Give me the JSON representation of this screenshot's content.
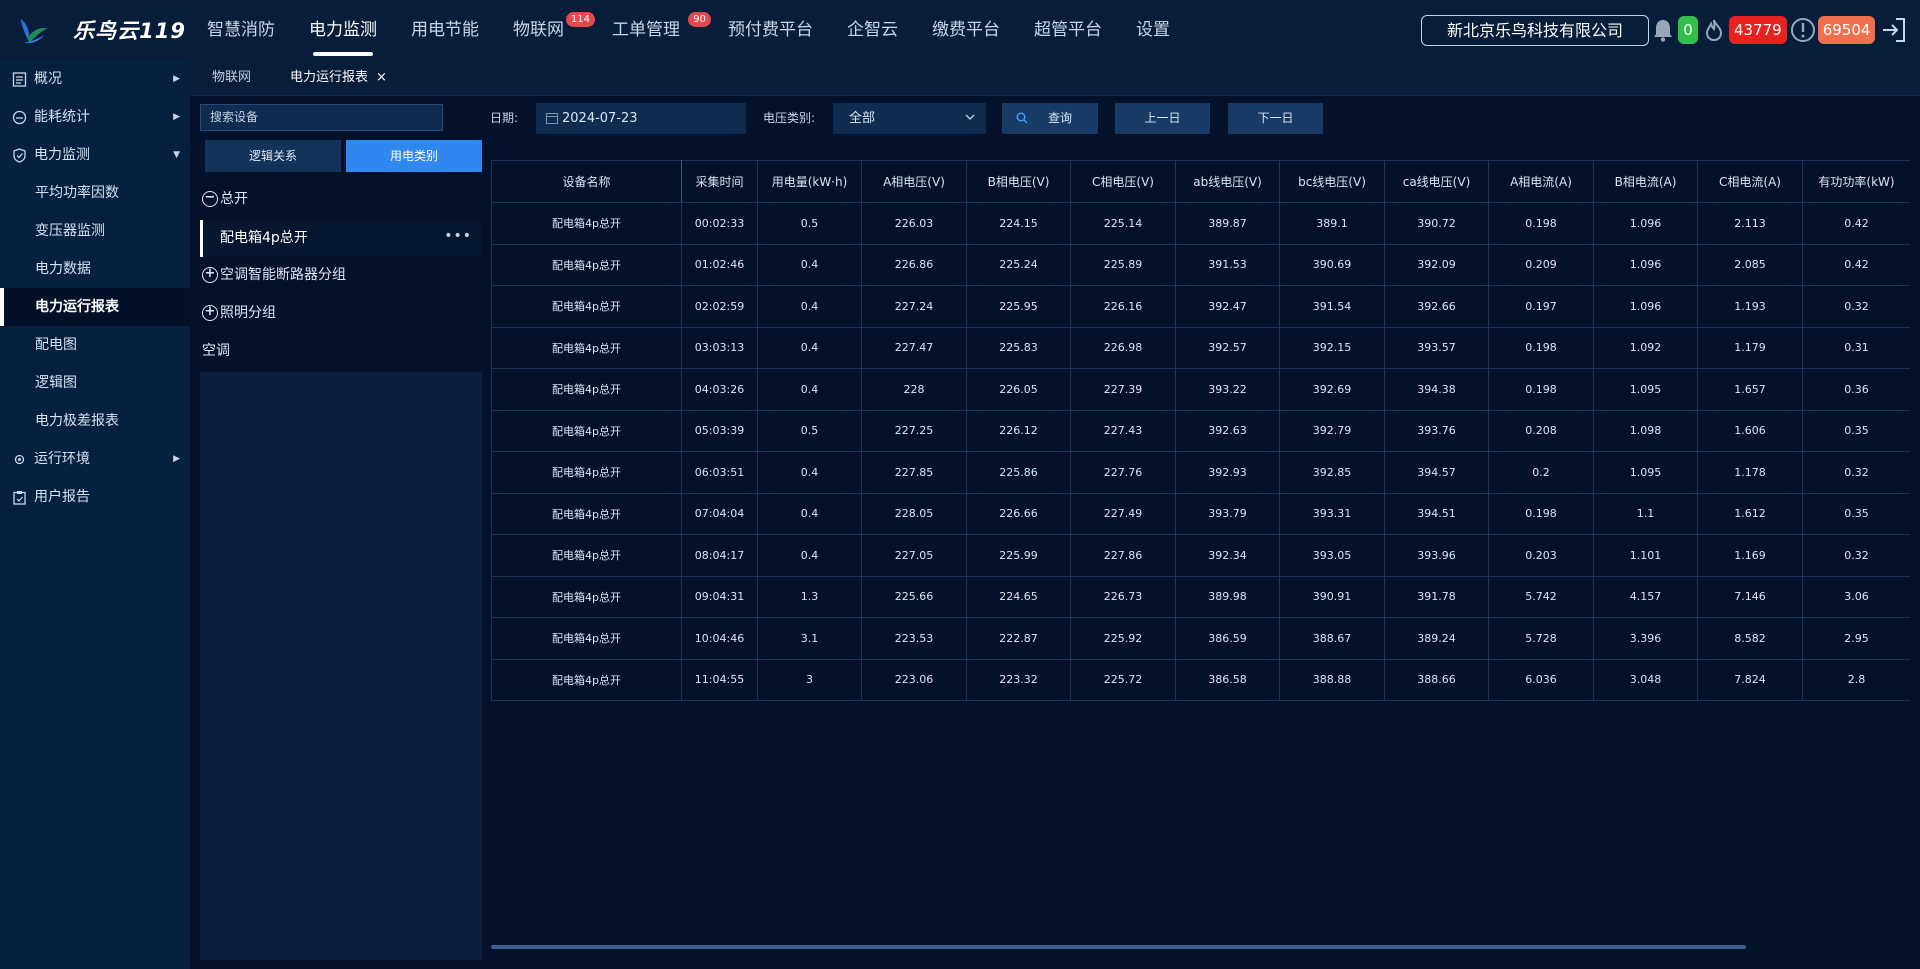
{
  "brand": {
    "name": "乐鸟云119"
  },
  "nav": [
    {
      "label": "智慧消防"
    },
    {
      "label": "电力监测",
      "active": true
    },
    {
      "label": "用电节能"
    },
    {
      "label": "物联网",
      "badge": "114"
    },
    {
      "label": "工单管理",
      "badge": "90"
    },
    {
      "label": "预付费平台"
    },
    {
      "label": "企智云"
    },
    {
      "label": "缴费平台"
    },
    {
      "label": "超管平台"
    },
    {
      "label": "设置"
    }
  ],
  "company": "新北京乐鸟科技有限公司",
  "status": {
    "green_count": "0",
    "red_count": "43779",
    "orange_count": "69504"
  },
  "sidebar": {
    "items": [
      {
        "label": "概况"
      },
      {
        "label": "能耗统计"
      },
      {
        "label": "电力监测"
      }
    ],
    "subitems": [
      "平均功率因数",
      "变压器监测",
      "电力数据",
      "电力运行报表",
      "配电图",
      "逻辑图",
      "电力极差报表"
    ],
    "bottom": [
      {
        "label": "运行环境"
      },
      {
        "label": "用户报告"
      }
    ]
  },
  "tabs": [
    {
      "label": "物联网"
    },
    {
      "label": "电力运行报表",
      "close": "×"
    }
  ],
  "tree": {
    "search_placeholder": "搜索设备",
    "seg_left": "逻辑关系",
    "seg_right": "用电类别",
    "node_total": "总开",
    "node_total_sign": "−",
    "selected": "配电箱4p总开",
    "selected_more": "•••",
    "node_ac_group": "空调智能断路器分组",
    "node_light_group": "照明分组",
    "plus_sign": "+",
    "node_ac": "空调"
  },
  "filter": {
    "date_label": "日期:",
    "date_value": "2024-07-23",
    "volt_label": "电压类别:",
    "volt_value": "全部",
    "search_btn": "查询",
    "prev_btn": "上一日",
    "next_btn": "下一日"
  },
  "table": {
    "headers": [
      "设备名称",
      "采集时间",
      "用电量(kW·h)",
      "A相电压(V)",
      "B相电压(V)",
      "C相电压(V)",
      "ab线电压(V)",
      "bc线电压(V)",
      "ca线电压(V)",
      "A相电流(A)",
      "B相电流(A)",
      "C相电流(A)",
      "有功功率(kW)"
    ],
    "rows": [
      [
        "配电箱4p总开",
        "00:02:33",
        "0.5",
        "226.03",
        "224.15",
        "225.14",
        "389.87",
        "389.1",
        "390.72",
        "0.198",
        "1.096",
        "2.113",
        "0.42"
      ],
      [
        "配电箱4p总开",
        "01:02:46",
        "0.4",
        "226.86",
        "225.24",
        "225.89",
        "391.53",
        "390.69",
        "392.09",
        "0.209",
        "1.096",
        "2.085",
        "0.42"
      ],
      [
        "配电箱4p总开",
        "02:02:59",
        "0.4",
        "227.24",
        "225.95",
        "226.16",
        "392.47",
        "391.54",
        "392.66",
        "0.197",
        "1.096",
        "1.193",
        "0.32"
      ],
      [
        "配电箱4p总开",
        "03:03:13",
        "0.4",
        "227.47",
        "225.83",
        "226.98",
        "392.57",
        "392.15",
        "393.57",
        "0.198",
        "1.092",
        "1.179",
        "0.31"
      ],
      [
        "配电箱4p总开",
        "04:03:26",
        "0.4",
        "228",
        "226.05",
        "227.39",
        "393.22",
        "392.69",
        "394.38",
        "0.198",
        "1.095",
        "1.657",
        "0.36"
      ],
      [
        "配电箱4p总开",
        "05:03:39",
        "0.5",
        "227.25",
        "226.12",
        "227.43",
        "392.63",
        "392.79",
        "393.76",
        "0.208",
        "1.098",
        "1.606",
        "0.35"
      ],
      [
        "配电箱4p总开",
        "06:03:51",
        "0.4",
        "227.85",
        "225.86",
        "227.76",
        "392.93",
        "392.85",
        "394.57",
        "0.2",
        "1.095",
        "1.178",
        "0.32"
      ],
      [
        "配电箱4p总开",
        "07:04:04",
        "0.4",
        "228.05",
        "226.66",
        "227.49",
        "393.79",
        "393.31",
        "394.51",
        "0.198",
        "1.1",
        "1.612",
        "0.35"
      ],
      [
        "配电箱4p总开",
        "08:04:17",
        "0.4",
        "227.05",
        "225.99",
        "227.86",
        "392.34",
        "393.05",
        "393.96",
        "0.203",
        "1.101",
        "1.169",
        "0.32"
      ],
      [
        "配电箱4p总开",
        "09:04:31",
        "1.3",
        "225.66",
        "224.65",
        "226.73",
        "389.98",
        "390.91",
        "391.78",
        "5.742",
        "4.157",
        "7.146",
        "3.06"
      ],
      [
        "配电箱4p总开",
        "10:04:46",
        "3.1",
        "223.53",
        "222.87",
        "225.92",
        "386.59",
        "388.67",
        "389.24",
        "5.728",
        "3.396",
        "8.582",
        "2.95"
      ],
      [
        "配电箱4p总开",
        "11:04:55",
        "3",
        "223.06",
        "223.32",
        "225.72",
        "386.58",
        "388.88",
        "388.66",
        "6.036",
        "3.048",
        "7.824",
        "2.8"
      ]
    ]
  },
  "colors": {
    "accent": "#2f87f0",
    "background": "#03112b",
    "green_badge": "#2fbf4a",
    "red_badge": "#e8231f",
    "orange_badge": "#f0704e"
  }
}
